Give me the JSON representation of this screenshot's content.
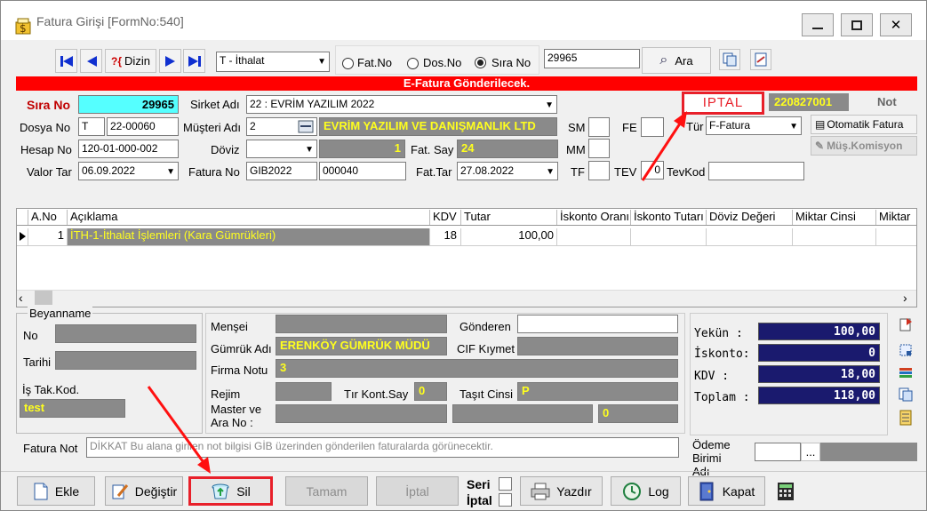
{
  "window": {
    "title": "Fatura Girişi [FormNo:540]"
  },
  "toolbar": {
    "dizin_label": "Dizin",
    "type_value": "T - İthalat",
    "radio_fatno": "Fat.No",
    "radio_dosno": "Dos.No",
    "radio_sirano": "Sıra No",
    "search_value": "29965",
    "ara_label": "Ara"
  },
  "banner": "E-Fatura Gönderilecek.",
  "header": {
    "sira_no_label": "Sıra No",
    "sira_no": "29965",
    "sirket_label": "Sirket Adı",
    "sirket_value": "22 : EVRİM YAZILIM  2022",
    "iptal_label": "IPTAL",
    "iptal_code": "220827001",
    "not_label": "Not",
    "dosya_label": "Dosya No",
    "dosya_prefix": "T",
    "dosya_no": "22-00060",
    "musteri_label": "Müşteri Adı",
    "musteri_code": "2",
    "musteri_name": "EVRİM YAZILIM VE DANIŞMANLIK LTD",
    "sm_label": "SM",
    "fe_label": "FE",
    "tur_label": "Tür",
    "tur_value": "F-Fatura",
    "otomatik_label": "Otomatik Fatura",
    "muskom_label": "Müş.Komisyon",
    "hesap_label": "Hesap No",
    "hesap_no": "120-01-000-002",
    "doviz_label": "Döviz",
    "doviz_rate": "1",
    "fatsay_label": "Fat. Say",
    "fatsay_value": "24",
    "mm_label": "MM",
    "valor_label": "Valor Tar",
    "valor_value": "06.09.2022",
    "fatno_label": "Fatura No",
    "fatno_prefix": "GIB2022",
    "fatno_value": "000040",
    "fattar_label": "Fat.Tar",
    "fattar_value": "27.08.2022",
    "tf_label": "TF",
    "tev_label": "TEV",
    "tev_value": "0",
    "tevkod_label": "TevKod"
  },
  "grid": {
    "columns": [
      "A.No",
      "Açıklama",
      "KDV",
      "Tutar",
      "İskonto Oranı",
      "İskonto Tutarı",
      "Döviz Değeri",
      "Miktar Cinsi",
      "Miktar"
    ],
    "rows": [
      {
        "ano": "1",
        "aciklama": "İTH-1-İthalat İşlemleri  (Kara Gümrükleri)",
        "kdv": "18",
        "tutar": "100,00"
      }
    ]
  },
  "beyanname": {
    "group_label": "Beyanname",
    "no_label": "No",
    "tarihi_label": "Tarihi",
    "istak_label": "İş Tak.Kod.",
    "istak_value": "test"
  },
  "details": {
    "mense_label": "Menşei",
    "gonderen_label": "Gönderen",
    "gumruk_label": "Gümrük Adı",
    "gumruk_value": "ERENKÖY GÜMRÜK MÜDÜ",
    "cif_label": "CIF Kıymet",
    "firma_label": "Firma Notu",
    "firma_value": "3",
    "rejim_label": "Rejim",
    "tir_label": "Tır Kont.Say",
    "tir_value": "0",
    "tasit_label": "Taşıt Cinsi",
    "tasit_value": "P",
    "master_label_1": "Master ve",
    "master_label_2": "Ara No :",
    "master_value": "0"
  },
  "totals": {
    "yekun_label": "Yekün   :",
    "yekun": "100,00",
    "iskonto_label": "İskonto:",
    "iskonto": "0",
    "kdv_label": "KDV     :",
    "kdv": "18,00",
    "toplam_label": "Toplam  :",
    "toplam": "118,00"
  },
  "fatura_not": {
    "label": "Fatura Not",
    "placeholder": "DİKKAT Bu alana girilen not bilgisi GİB üzerinden gönderilen faturalarda görünecektir."
  },
  "odeme": {
    "label_1": "Ödeme",
    "label_2": "Birimi",
    "label_3": "Adı",
    "dots": "..."
  },
  "buttons": {
    "ekle": "Ekle",
    "degistir": "Değiştir",
    "sil": "Sil",
    "tamam": "Tamam",
    "iptal": "İptal",
    "seri": "Seri",
    "iptal_chk": "İptal",
    "yazdir": "Yazdır",
    "log": "Log",
    "kapat": "Kapat"
  },
  "colors": {
    "banner": "#ff0000",
    "highlight": "#e8202a",
    "grey_field": "#8a8a8a",
    "yellow_text": "#ffff1e",
    "navy": "#1a1a6e",
    "cyan": "#55ffff"
  }
}
